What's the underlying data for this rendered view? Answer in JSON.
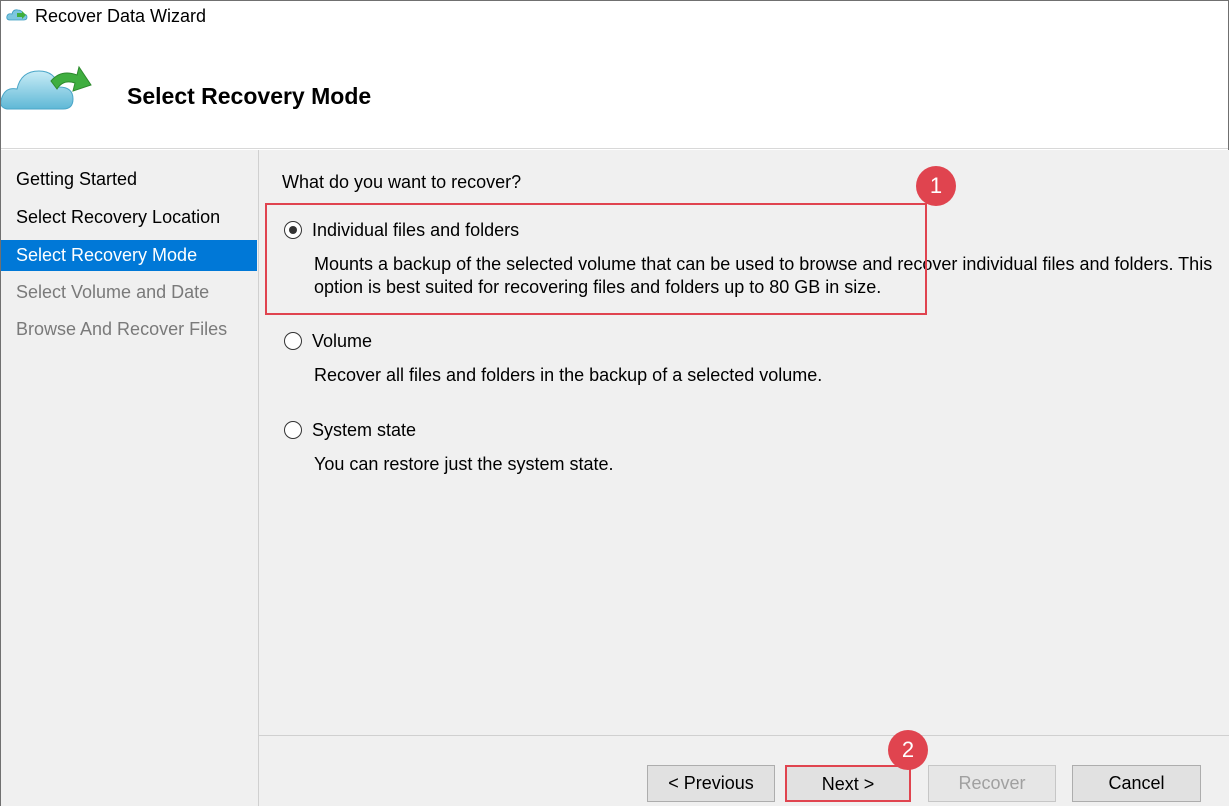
{
  "window": {
    "title": "Recover Data Wizard"
  },
  "header": {
    "heading": "Select Recovery Mode"
  },
  "nav": {
    "items": [
      {
        "label": "Getting Started",
        "state": "normal"
      },
      {
        "label": "Select Recovery Location",
        "state": "normal"
      },
      {
        "label": "Select Recovery Mode",
        "state": "active"
      },
      {
        "label": "Select Volume and Date",
        "state": "disabled"
      },
      {
        "label": "Browse And Recover Files",
        "state": "disabled"
      }
    ]
  },
  "main": {
    "question": "What do you want to recover?",
    "options": [
      {
        "label": "Individual files and folders",
        "selected": true,
        "desc_line1": "Mounts a backup of the selected volume that can be used to browse and recover individual files and folders. This",
        "desc_line2": "option is best suited for recovering files and folders up to 80 GB in size."
      },
      {
        "label": "Volume",
        "selected": false,
        "desc_line1": "Recover all files and folders in the backup of a selected volume."
      },
      {
        "label": "System state",
        "selected": false,
        "desc_line1": "You can restore just the system state."
      }
    ]
  },
  "annotations": {
    "callout1": "1",
    "callout2": "2",
    "color": "#e0444f"
  },
  "footer": {
    "previous_label": "< Previous",
    "next_label": "Next >",
    "recover_label": "Recover",
    "cancel_label": "Cancel"
  },
  "colors": {
    "accent": "#0078d7",
    "panel": "#f0f0f0"
  }
}
